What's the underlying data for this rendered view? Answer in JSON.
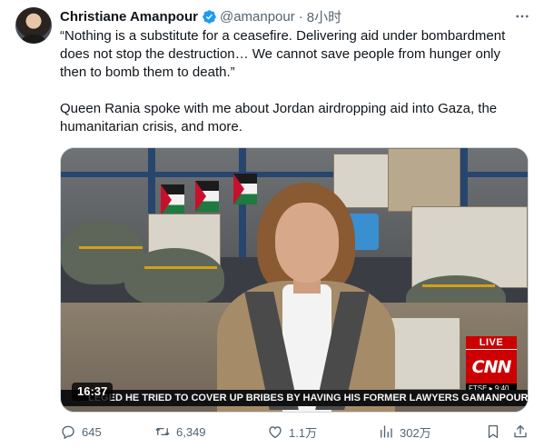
{
  "tweet": {
    "author_name": "Christiane Amanpour",
    "handle": "@amanpour",
    "separator": "·",
    "time": "8小时",
    "paragraph1": "“Nothing is a substitute for a ceasefire. Delivering aid under bombardment\ndoes not stop the destruction… We cannot save people from hunger only\nthen to bomb them to death.”",
    "paragraph2": "Queen Rania spoke with me about Jordan airdropping aid into Gaza, the\nhumanitarian crisis, and more."
  },
  "video": {
    "duration": "16:37",
    "live_label": "LIVE",
    "network_logo": "CNN",
    "ftse_text": "FTSE ▸ 9:40",
    "ticker_text": "LEGED HE TRIED TO COVER UP BRIBES BY HAVING HIS FORMER LAWYERS G",
    "ticker_show": "AMANPOUR"
  },
  "actions": {
    "replies": "645",
    "reposts": "6,349",
    "likes": "1.1万",
    "views": "302万"
  },
  "icons": {
    "verified": "verified-badge-icon",
    "more": "more-icon",
    "reply": "reply-icon",
    "repost": "repost-icon",
    "like": "like-icon",
    "views": "views-icon",
    "bookmark": "bookmark-icon",
    "share": "share-icon"
  },
  "colors": {
    "text_primary": "#0f1419",
    "text_secondary": "#536471",
    "verified_blue": "#1d9bf0",
    "cnn_red": "#cc0000"
  }
}
